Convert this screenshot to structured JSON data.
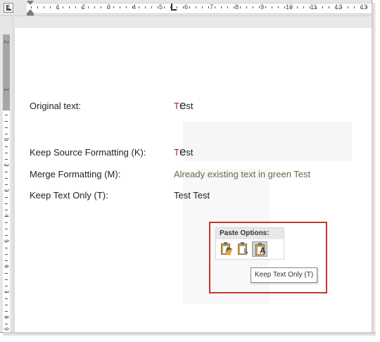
{
  "ruler": {
    "numbers": [
      "1",
      "1",
      "2",
      "3",
      "4",
      "5",
      "6",
      "7",
      "8",
      "9",
      "10",
      "11",
      "12",
      "13"
    ],
    "vertical_numbers": [
      "2",
      "1",
      "1",
      "2",
      "3",
      "4",
      "5",
      "6",
      "7",
      "8",
      "9"
    ]
  },
  "document": {
    "original": {
      "label": "Original text:",
      "value_t": "T",
      "value_e": "e",
      "value_rest": "st"
    },
    "keep_source": {
      "label": "Keep Source Formatting (K):",
      "value_t": "T",
      "value_e": "e",
      "value_rest": "st"
    },
    "merge": {
      "label": "Merge Formatting (M):",
      "value": "Already existing text in green Test"
    },
    "keep_text": {
      "label": "Keep Text Only (T):",
      "value": "Test Test"
    }
  },
  "paste_options": {
    "header": "Paste Options:",
    "buttons": [
      {
        "icon": "keep-source-formatting-icon"
      },
      {
        "icon": "merge-formatting-icon"
      },
      {
        "icon": "keep-text-only-icon",
        "selected": true
      }
    ],
    "tooltip": "Keep Text Only (T)"
  },
  "colors": {
    "accent_red": "#c0392b",
    "original_t": "#9c2b1b",
    "merge_green": "#5a6e47"
  }
}
